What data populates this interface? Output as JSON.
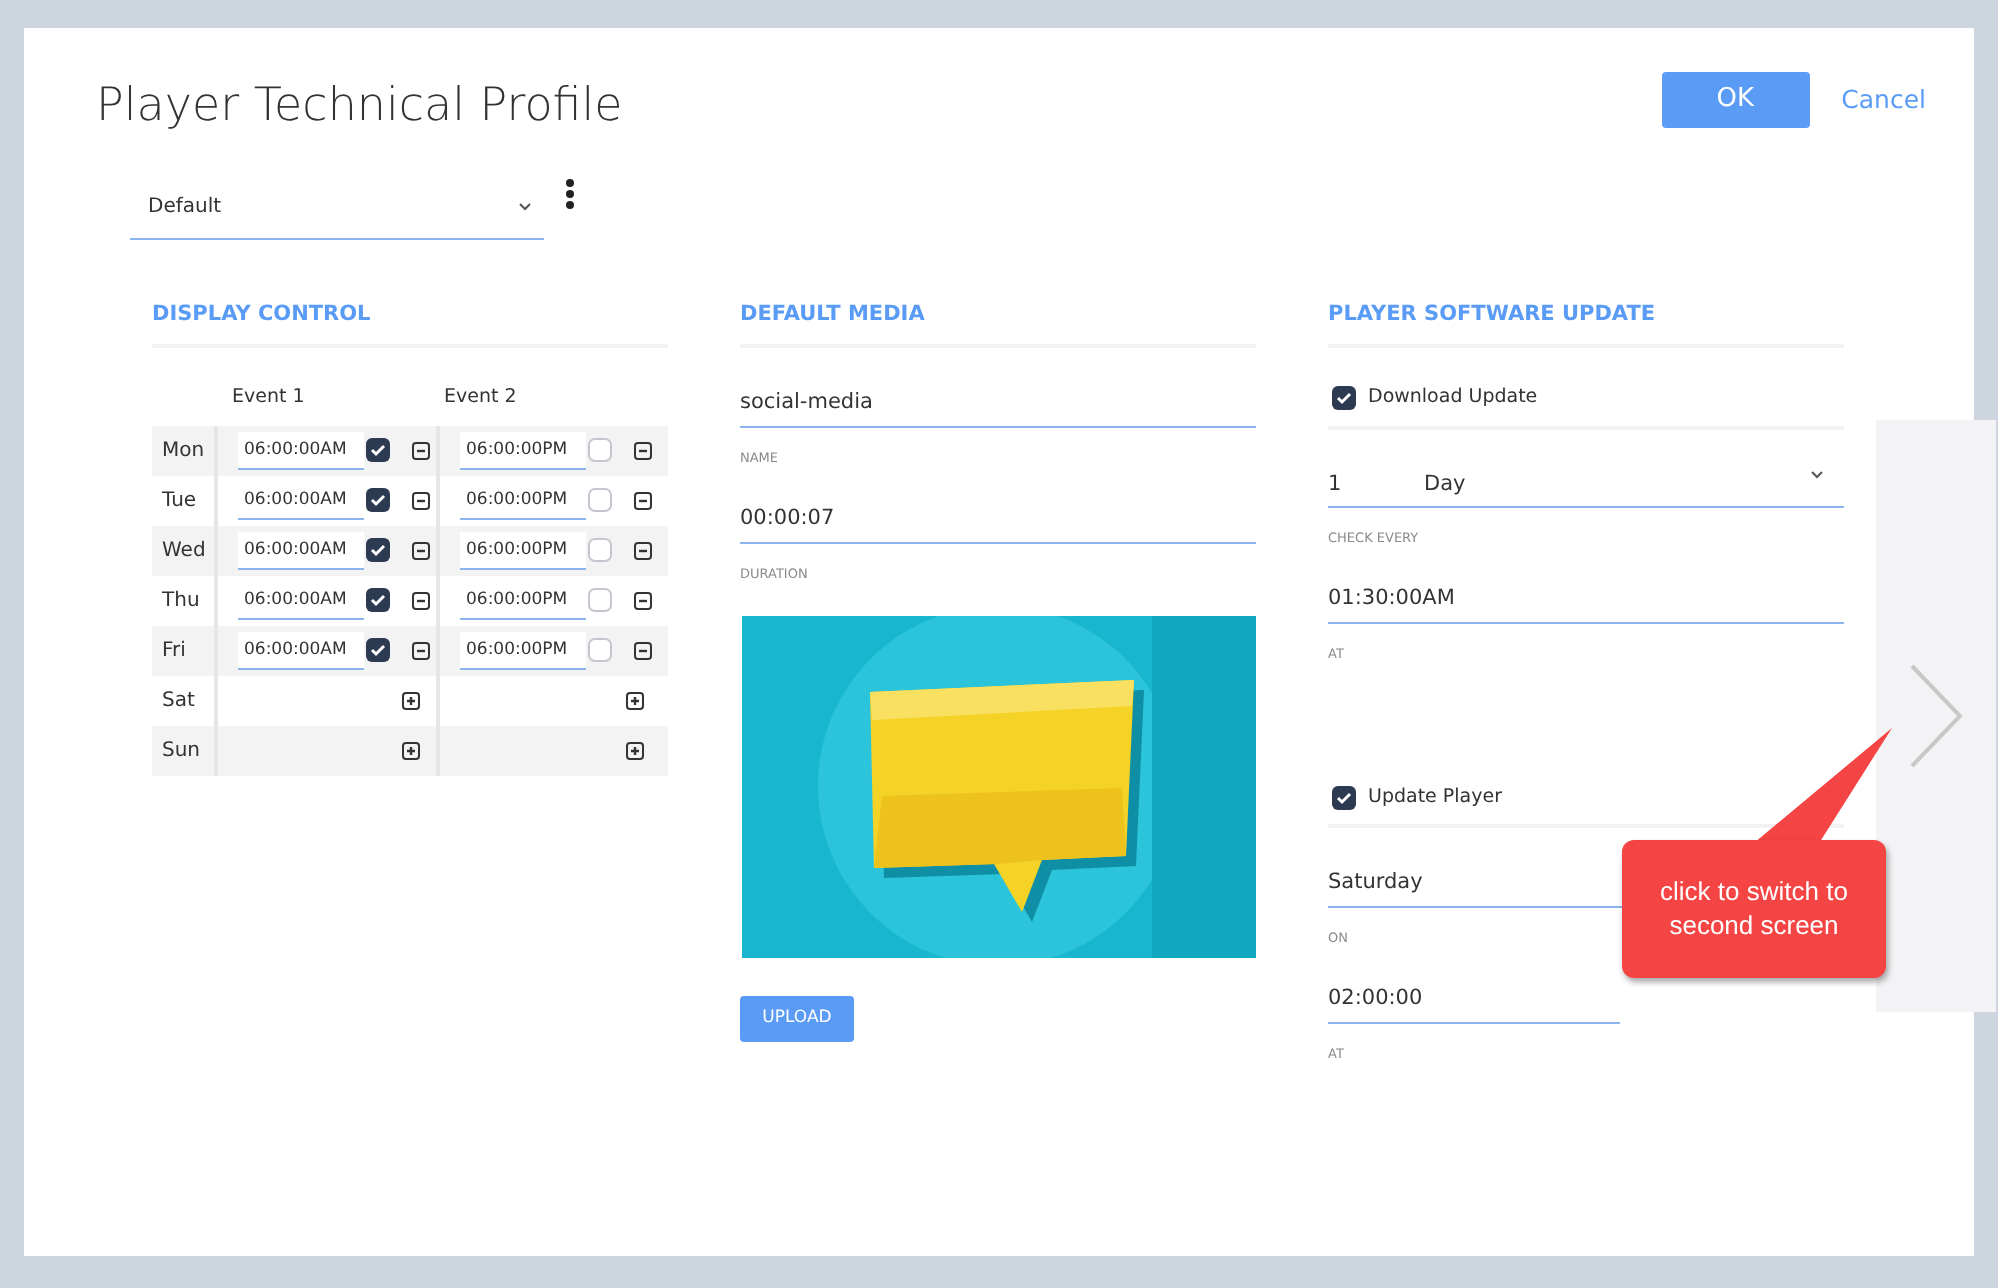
{
  "dialog": {
    "title": "Player Technical Profile",
    "buttons": [
      {
        "label": "OK",
        "kind": "primary"
      },
      {
        "label": "Cancel",
        "kind": "link"
      }
    ]
  },
  "profile_select": {
    "value": "Default"
  },
  "display_control": {
    "heading": "DISPLAY CONTROL",
    "columns": [
      "Event 1",
      "Event 2"
    ],
    "rows": [
      {
        "day": "Mon",
        "events": [
          {
            "kind": "time",
            "time": "06:00:00AM",
            "checked": true
          },
          {
            "kind": "time",
            "time": "06:00:00PM",
            "checked": false
          }
        ]
      },
      {
        "day": "Tue",
        "events": [
          {
            "kind": "time",
            "time": "06:00:00AM",
            "checked": true
          },
          {
            "kind": "time",
            "time": "06:00:00PM",
            "checked": false
          }
        ]
      },
      {
        "day": "Wed",
        "events": [
          {
            "kind": "time",
            "time": "06:00:00AM",
            "checked": true
          },
          {
            "kind": "time",
            "time": "06:00:00PM",
            "checked": false
          }
        ]
      },
      {
        "day": "Thu",
        "events": [
          {
            "kind": "time",
            "time": "06:00:00AM",
            "checked": true
          },
          {
            "kind": "time",
            "time": "06:00:00PM",
            "checked": false
          }
        ]
      },
      {
        "day": "Fri",
        "events": [
          {
            "kind": "time",
            "time": "06:00:00AM",
            "checked": true
          },
          {
            "kind": "time",
            "time": "06:00:00PM",
            "checked": false
          }
        ]
      },
      {
        "day": "Sat",
        "events": [
          {
            "kind": "empty"
          },
          {
            "kind": "empty"
          }
        ]
      },
      {
        "day": "Sun",
        "events": [
          {
            "kind": "empty"
          },
          {
            "kind": "empty"
          }
        ]
      }
    ]
  },
  "default_media": {
    "heading": "DEFAULT MEDIA",
    "fields": [
      {
        "label": "NAME",
        "value": "social-media"
      },
      {
        "label": "DURATION",
        "value": "00:00:07"
      }
    ],
    "upload_button": "UPLOAD"
  },
  "software_update": {
    "heading": "PLAYER SOFTWARE UPDATE",
    "sections": [
      {
        "label": "Download Update",
        "checked": true,
        "fields": [
          {
            "kind": "interval",
            "value": "1",
            "unit": "Day",
            "label": "CHECK EVERY"
          },
          {
            "kind": "text",
            "value": "01:30:00AM",
            "label": "AT"
          }
        ]
      },
      {
        "label": "Update Player",
        "checked": true,
        "fields": [
          {
            "kind": "select",
            "value": "Saturday",
            "label": "ON"
          },
          {
            "kind": "text",
            "value": "02:00:00",
            "label": "AT"
          }
        ]
      }
    ]
  },
  "callout": {
    "text": "click to switch to second screen"
  }
}
